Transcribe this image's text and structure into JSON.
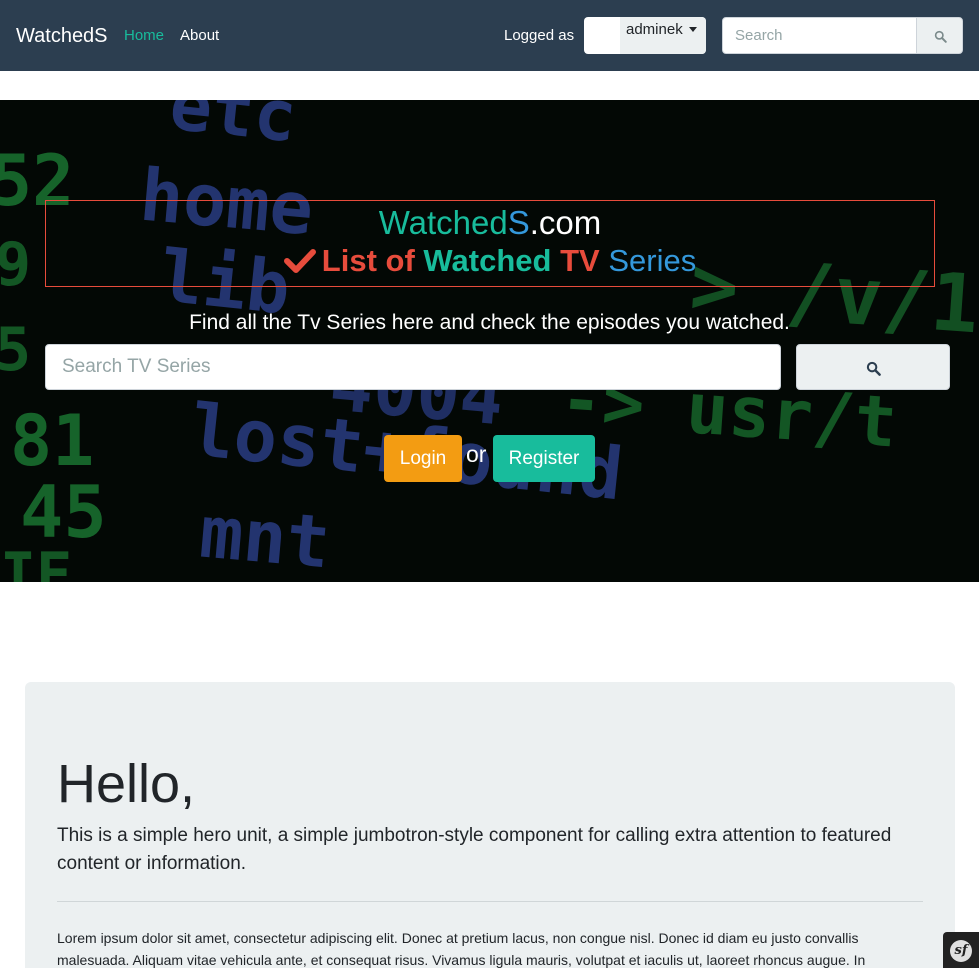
{
  "navbar": {
    "brand": "WatchedS",
    "links": [
      {
        "label": "Home",
        "active": true
      },
      {
        "label": "About",
        "active": false
      }
    ],
    "logged_label": "Logged as",
    "user": "adminek",
    "search_placeholder": "Search",
    "search_icon": "search-icon"
  },
  "hero": {
    "title_part1": "Watched",
    "title_part2": "S",
    "title_part3": ".com",
    "subtitle_icon": "check-icon",
    "subtitle_part1": "List of",
    "subtitle_part2": "Watched",
    "subtitle_part3": "TV",
    "subtitle_part4": "Series",
    "tagline": "Find all the Tv Series here and check the episodes you watched.",
    "search_placeholder": "Search TV Series",
    "login_label": "Login",
    "or_text": "or",
    "register_label": "Register"
  },
  "jumbotron": {
    "heading": "Hello,",
    "lead": "This is a simple hero unit, a simple jumbotron-style component for calling extra attention to featured content or information.",
    "paragraph": "Lorem ipsum dolor sit amet, consectetur adipiscing elit. Donec at pretium lacus, non congue nisl. Donec id diam eu justo convallis malesuada. Aliquam vitae vehicula ante, et consequat risus. Vivamus ligula mauris, volutpat et iaculis ut, laoreet rhoncus augue. In"
  },
  "colors": {
    "navbar_bg": "#2c3e50",
    "accent_teal": "#18bc9c",
    "accent_red": "#e74c3c",
    "accent_blue": "#3498db",
    "login_orange": "#f39c12"
  },
  "debug_toolbar": {
    "icon": "symfony-logo-icon",
    "glyph": "sf"
  }
}
